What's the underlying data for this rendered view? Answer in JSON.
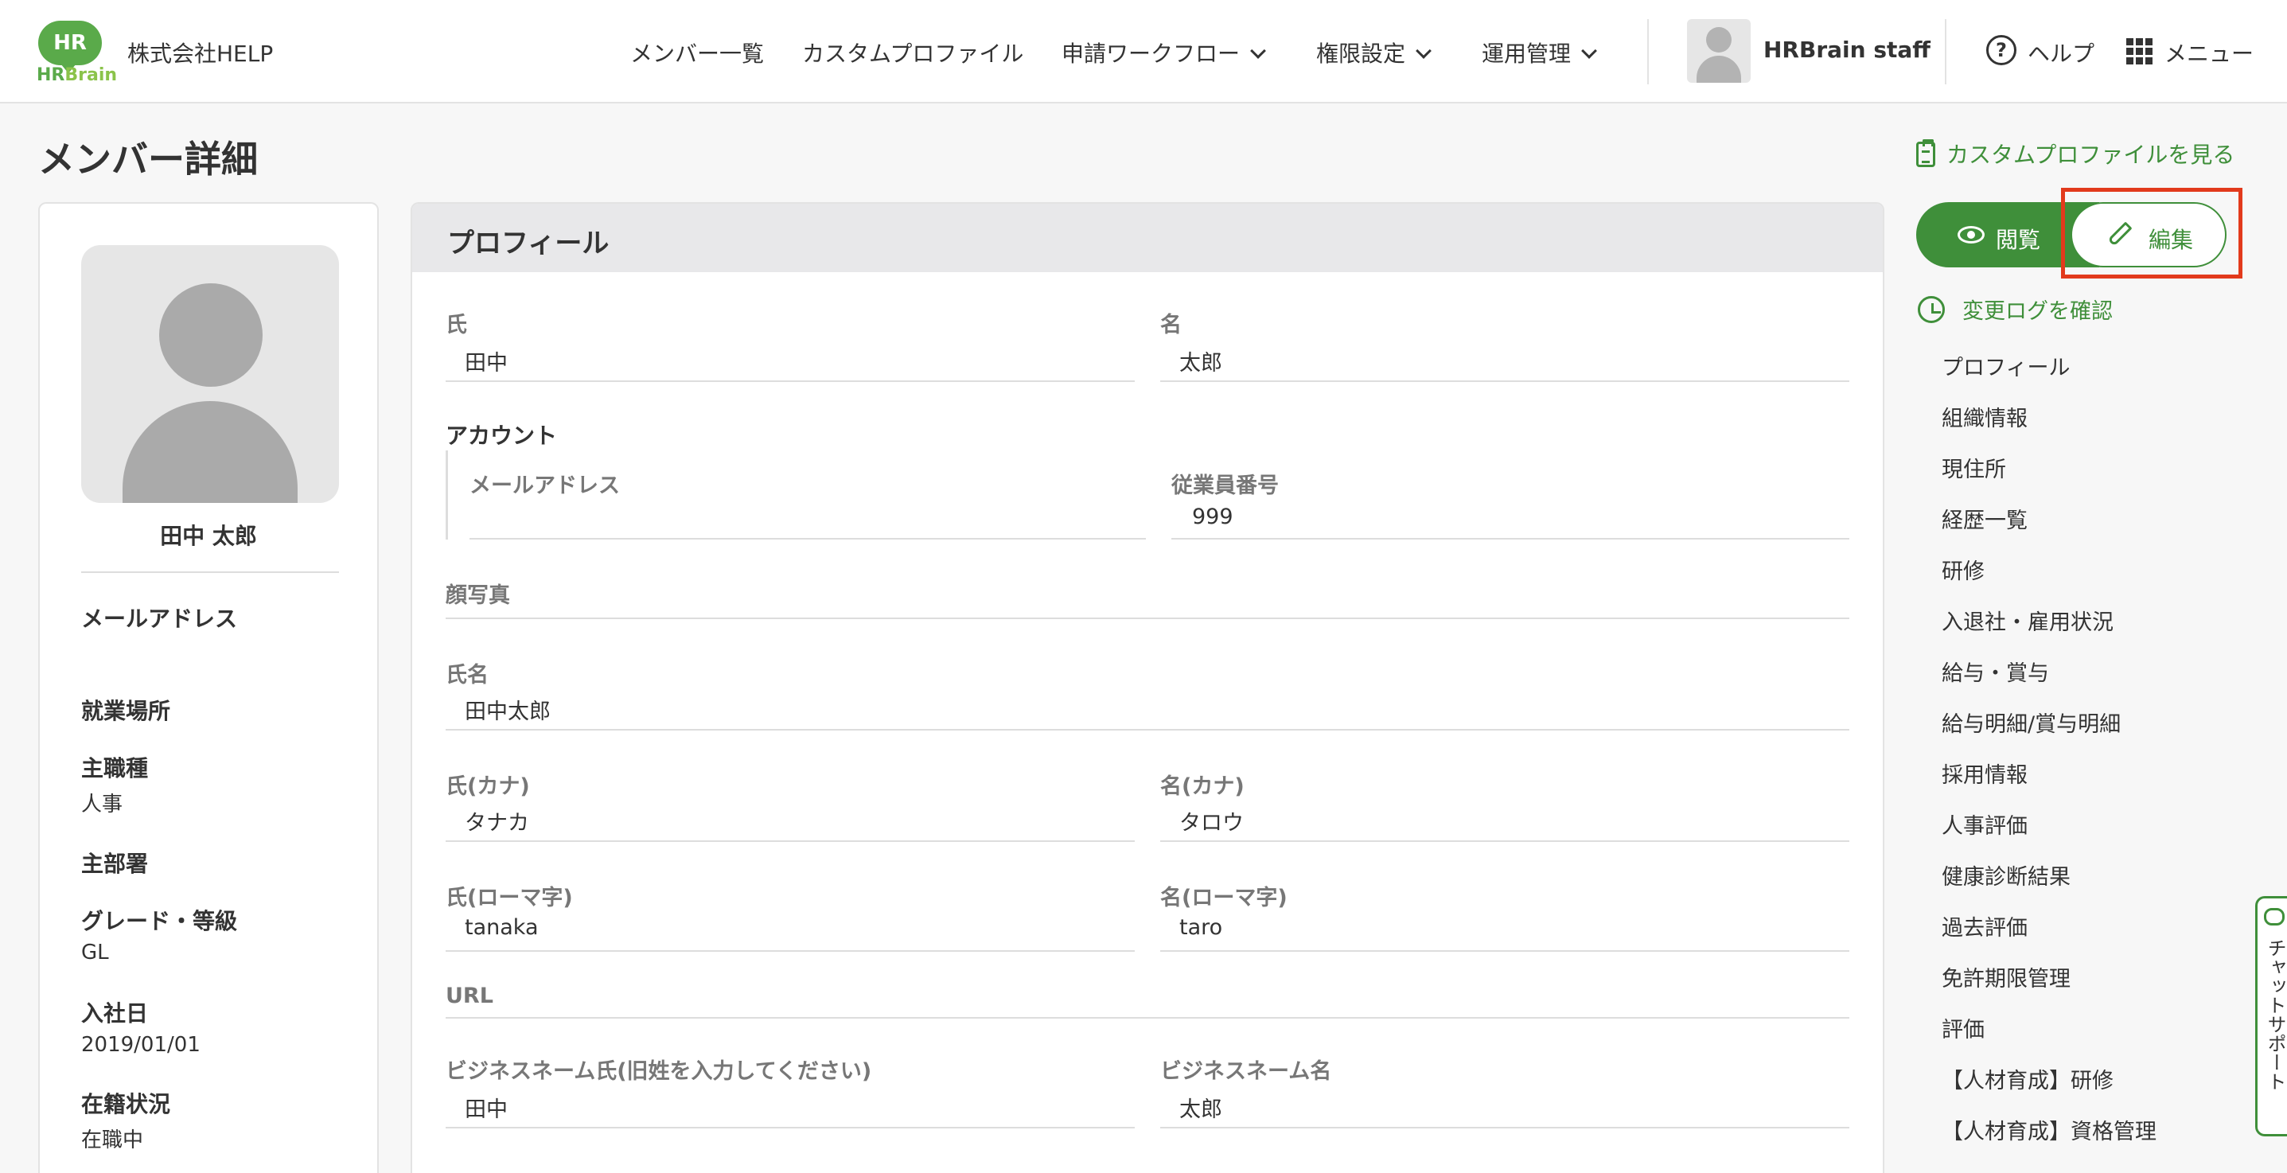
{
  "header": {
    "logo_mark": "HR",
    "logo_text_1": "HR",
    "logo_text_2": "Brain",
    "company": "株式会社HELP",
    "nav": {
      "members": "メンバー一覧",
      "custom_profile": "カスタムプロファイル",
      "workflow": "申請ワークフロー",
      "permissions": "権限設定",
      "operations": "運用管理"
    },
    "user_name": "HRBrain staff",
    "help": "ヘルプ",
    "help_glyph": "?",
    "menu": "メニュー"
  },
  "page": {
    "title": "メンバー詳細",
    "custom_profile_link": "カスタムプロファイルを見る"
  },
  "left_card": {
    "name": "田中 太郎",
    "email_label": "メールアドレス",
    "workplace_label": "就業場所",
    "job_type_label": "主職種",
    "job_type_value": "人事",
    "department_label": "主部署",
    "grade_label": "グレード・等級",
    "grade_value": "GL",
    "join_date_label": "入社日",
    "join_date_value": "2019/01/01",
    "status_label": "在籍状況",
    "status_value": "在職中"
  },
  "profile": {
    "title": "プロフィール",
    "last_name_label": "氏",
    "last_name": "田中",
    "first_name_label": "名",
    "first_name": "太郎",
    "account_section": "アカウント",
    "email_label": "メールアドレス",
    "email": "",
    "employee_no_label": "従業員番号",
    "employee_no": "999",
    "photo_label": "顔写真",
    "full_name_label": "氏名",
    "full_name": "田中太郎",
    "last_kana_label": "氏(カナ)",
    "last_kana": "タナカ",
    "first_kana_label": "名(カナ)",
    "first_kana": "タロウ",
    "last_roman_label": "氏(ローマ字)",
    "last_roman": "tanaka",
    "first_roman_label": "名(ローマ字)",
    "first_roman": "taro",
    "url_label": "URL",
    "biz_last_label": "ビジネスネーム氏(旧姓を入力してください)",
    "biz_last": "田中",
    "biz_first_label": "ビジネスネーム名",
    "biz_first": "太郎"
  },
  "actions": {
    "view": "閲覧",
    "edit": "編集",
    "change_log": "変更ログを確認"
  },
  "toc": [
    "プロフィール",
    "組織情報",
    "現住所",
    "経歴一覧",
    "研修",
    "入退社・雇用状況",
    "給与・賞与",
    "給与明細/賞与明細",
    "採用情報",
    "人事評価",
    "健康診断結果",
    "過去評価",
    "免許期限管理",
    "評価",
    "【人材育成】研修",
    "【人材育成】資格管理"
  ],
  "chat": {
    "label": "チャットサポート"
  },
  "colors": {
    "accent": "#3f8f3a",
    "highlight": "#e23a1c"
  }
}
